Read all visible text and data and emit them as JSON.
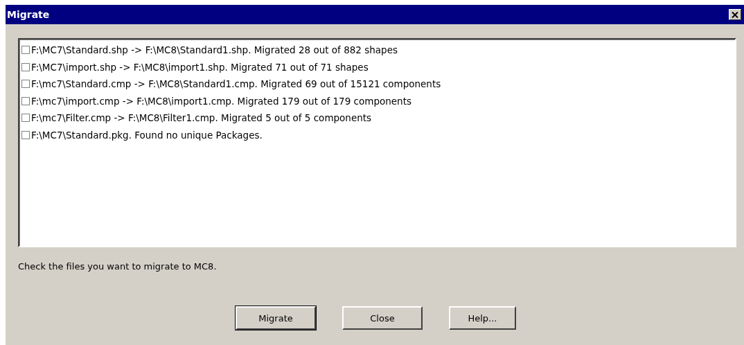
{
  "window": {
    "title": "Migrate"
  },
  "files": [
    {
      "label": "F:\\MC7\\Standard.shp -> F:\\MC8\\Standard1.shp. Migrated 28 out of 882 shapes",
      "checked": false
    },
    {
      "label": "F:\\MC7\\import.shp -> F:\\MC8\\import1.shp. Migrated 71 out of 71 shapes",
      "checked": false
    },
    {
      "label": "F:\\mc7\\Standard.cmp -> F:\\MC8\\Standard1.cmp. Migrated 69 out of 15121 components",
      "checked": false
    },
    {
      "label": "F:\\mc7\\import.cmp -> F:\\MC8\\import1.cmp. Migrated 179 out of 179 components",
      "checked": false
    },
    {
      "label": "F:\\mc7\\Filter.cmp -> F:\\MC8\\Filter1.cmp. Migrated 5 out of 5 components",
      "checked": false
    },
    {
      "label": "F:\\MC7\\Standard.pkg. Found no unique Packages.",
      "checked": false
    }
  ],
  "hint": "Check the files you want to migrate to MC8.",
  "buttons": [
    {
      "label": "Migrate",
      "default": true
    },
    {
      "label": "Close",
      "default": false
    },
    {
      "label": "Help...",
      "default": false
    }
  ]
}
